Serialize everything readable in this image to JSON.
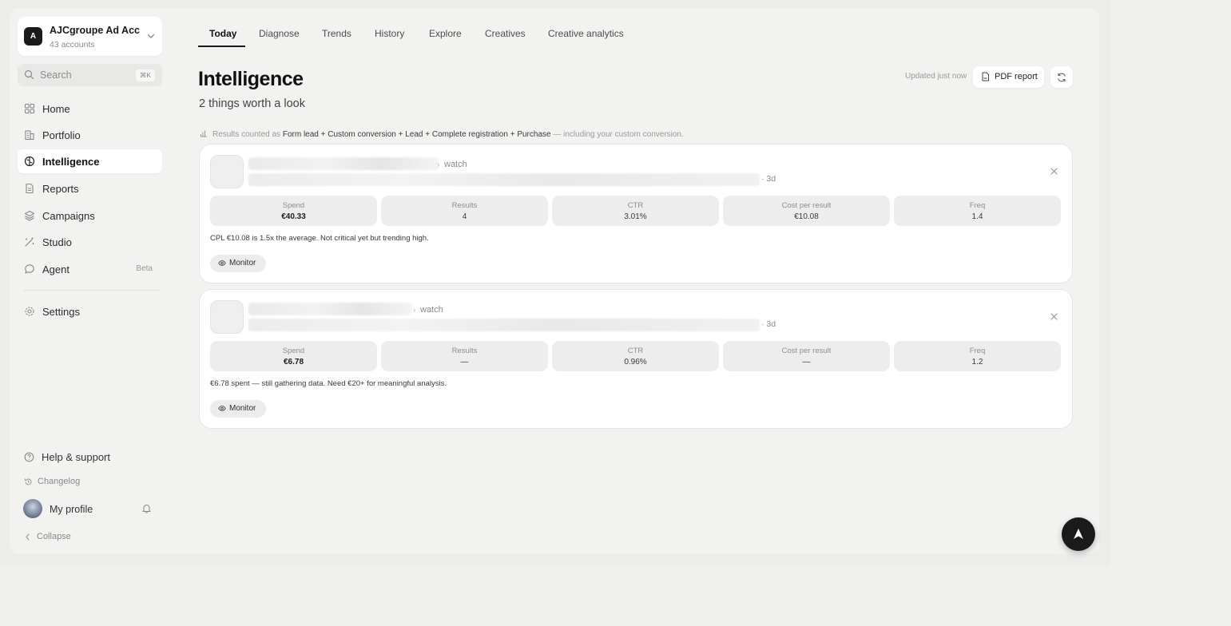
{
  "account": {
    "initial": "A",
    "name": "AJCgroupe Ad Acc",
    "sub": "43 accounts"
  },
  "search": {
    "placeholder": "Search",
    "shortcut": "⌘K"
  },
  "nav": [
    {
      "label": "Home",
      "icon": "grid-icon"
    },
    {
      "label": "Portfolio",
      "icon": "building-icon"
    },
    {
      "label": "Intelligence",
      "icon": "brain-icon",
      "active": true
    },
    {
      "label": "Reports",
      "icon": "document-icon"
    },
    {
      "label": "Campaigns",
      "icon": "layers-icon"
    },
    {
      "label": "Studio",
      "icon": "wand-icon"
    },
    {
      "label": "Agent",
      "icon": "chat-icon",
      "badge": "Beta"
    }
  ],
  "settings": "Settings",
  "footer": {
    "help": "Help & support",
    "changelog": "Changelog",
    "profile": "My profile",
    "collapse": "Collapse"
  },
  "tabs": [
    "Today",
    "Diagnose",
    "Trends",
    "History",
    "Explore",
    "Creatives",
    "Creative analytics"
  ],
  "header": {
    "title": "Intelligence",
    "subtitle": "2 things worth a look",
    "updated": "Updated just now",
    "pdf": "PDF report"
  },
  "note": {
    "prefix": "Results counted as",
    "bold": "Form lead + Custom conversion + Lead + Complete registration + Purchase",
    "suffix": "— including your custom conversion."
  },
  "cards": [
    {
      "arrow": "›",
      "status": "watch",
      "age": "· 3d",
      "metrics": [
        {
          "label": "Spend",
          "value": "€40.33"
        },
        {
          "label": "Results",
          "value": "4"
        },
        {
          "label": "CTR",
          "value": "3.01%"
        },
        {
          "label": "Cost per result",
          "value": "€10.08"
        },
        {
          "label": "Freq",
          "value": "1.4"
        }
      ],
      "desc": "CPL €10.08 is 1.5x the average. Not critical yet but trending high.",
      "action": "Monitor"
    },
    {
      "arrow": "›",
      "status": "watch",
      "age": "· 3d",
      "metrics": [
        {
          "label": "Spend",
          "value": "€6.78"
        },
        {
          "label": "Results",
          "value": "—"
        },
        {
          "label": "CTR",
          "value": "0.96%"
        },
        {
          "label": "Cost per result",
          "value": "—"
        },
        {
          "label": "Freq",
          "value": "1.2"
        }
      ],
      "desc": "€6.78 spent — still gathering data. Need €20+ for meaningful analysis.",
      "action": "Monitor"
    }
  ],
  "colors": {
    "accent": "#1a1a1a",
    "background": "#f2f2f1",
    "card": "#ffffff"
  }
}
